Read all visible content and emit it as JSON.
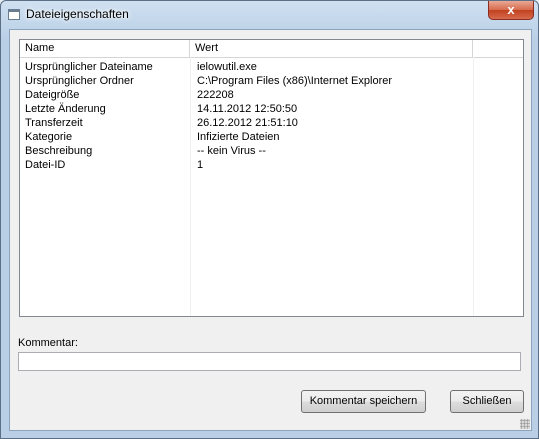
{
  "window": {
    "title": "Dateieigenschaften",
    "close_label": "x"
  },
  "properties": {
    "columns": [
      "Name",
      "Wert"
    ],
    "rows": [
      {
        "name": "Ursprünglicher Dateiname",
        "value": "ielowutil.exe"
      },
      {
        "name": "Ursprünglicher Ordner",
        "value": "C:\\Program Files (x86)\\Internet Explorer"
      },
      {
        "name": "Dateigröße",
        "value": "222208"
      },
      {
        "name": "Letzte Änderung",
        "value": "14.11.2012 12:50:50"
      },
      {
        "name": "Transferzeit",
        "value": "26.12.2012 21:51:10"
      },
      {
        "name": "Kategorie",
        "value": "Infizierte Dateien"
      },
      {
        "name": "Beschreibung",
        "value": "-- kein Virus --"
      },
      {
        "name": "Datei-ID",
        "value": "1"
      }
    ]
  },
  "comment": {
    "label": "Kommentar:",
    "value": ""
  },
  "buttons": {
    "save_label": "Kommentar speichern",
    "close_label": "Schließen"
  }
}
